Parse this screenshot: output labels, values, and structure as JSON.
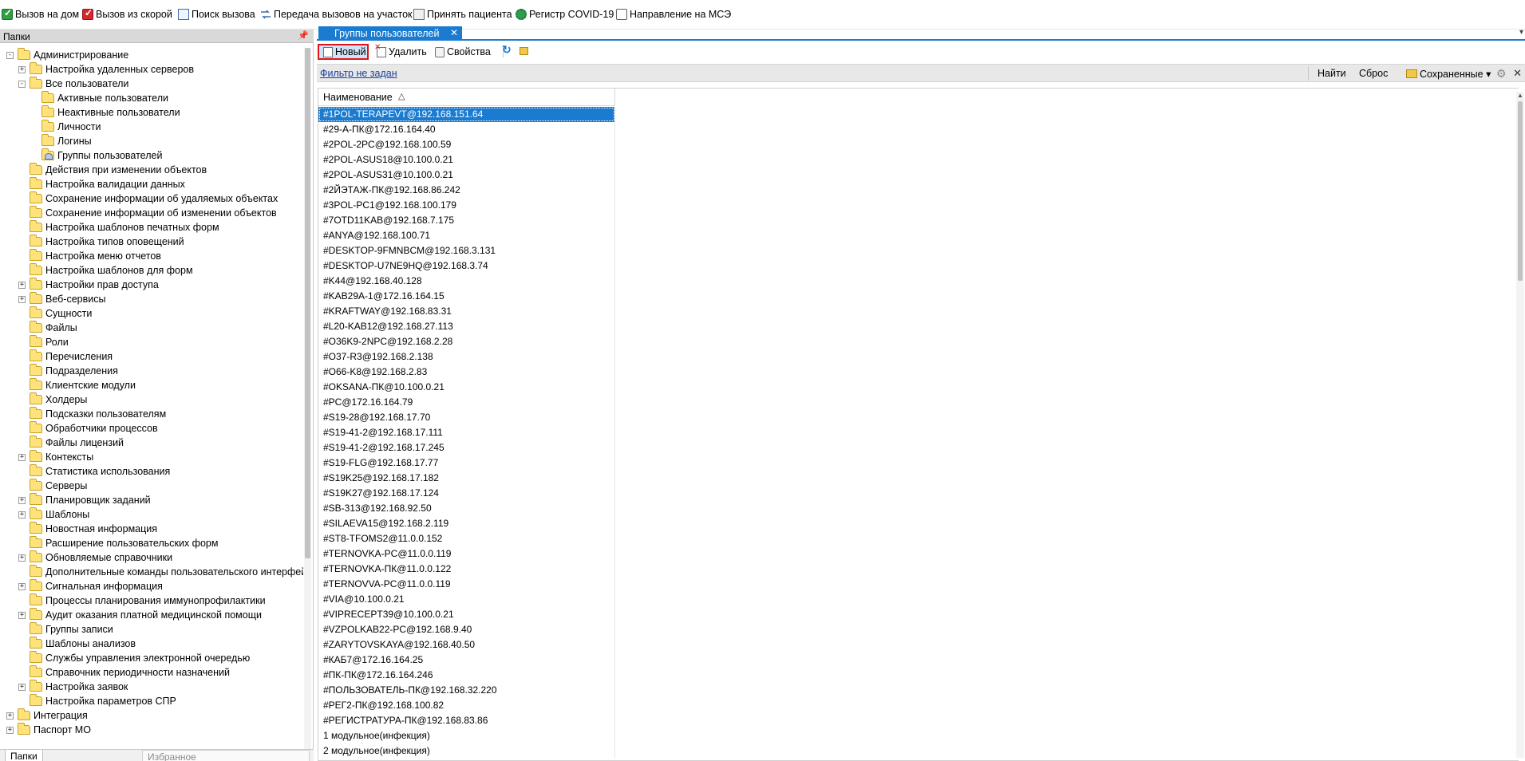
{
  "toolbar": {
    "items": [
      {
        "label": "Вызов на дом",
        "icon": "home-call-icon"
      },
      {
        "label": "Вызов из скорой",
        "icon": "ambulance-call-icon"
      },
      {
        "label": "Поиск вызова",
        "icon": "search-call-icon"
      },
      {
        "label": "Передача вызовов на участок",
        "icon": "transfer-icon"
      },
      {
        "label": "Принять пациента",
        "icon": "accept-patient-icon"
      },
      {
        "label": "Регистр COVID-19",
        "icon": "covid-icon"
      },
      {
        "label": "Направление на МСЭ",
        "icon": "referral-icon"
      }
    ]
  },
  "left_panel": {
    "title": "Папки",
    "pin_icon": "pin-icon",
    "tabs": {
      "active": "Папки",
      "favorites": "Избранное"
    },
    "tree": [
      {
        "label": "Администрирование",
        "level": 0,
        "expander": "-"
      },
      {
        "label": "Настройка удаленных серверов",
        "level": 1,
        "expander": "+"
      },
      {
        "label": "Все пользователи",
        "level": 1,
        "expander": "-"
      },
      {
        "label": "Активные пользователи",
        "level": 2,
        "expander": ""
      },
      {
        "label": "Неактивные пользователи",
        "level": 2,
        "expander": ""
      },
      {
        "label": "Личности",
        "level": 2,
        "expander": ""
      },
      {
        "label": "Логины",
        "level": 2,
        "expander": ""
      },
      {
        "label": "Группы пользователей",
        "level": 2,
        "expander": "",
        "selected": true
      },
      {
        "label": "Действия при изменении объектов",
        "level": 1,
        "expander": ""
      },
      {
        "label": "Настройка валидации данных",
        "level": 1,
        "expander": ""
      },
      {
        "label": "Сохранение информации об удаляемых объектах",
        "level": 1,
        "expander": ""
      },
      {
        "label": "Сохранение информации об изменении объектов",
        "level": 1,
        "expander": ""
      },
      {
        "label": "Настройка шаблонов печатных форм",
        "level": 1,
        "expander": ""
      },
      {
        "label": "Настройка типов оповещений",
        "level": 1,
        "expander": ""
      },
      {
        "label": "Настройка меню отчетов",
        "level": 1,
        "expander": ""
      },
      {
        "label": "Настройка шаблонов для форм",
        "level": 1,
        "expander": ""
      },
      {
        "label": "Настройки прав доступа",
        "level": 1,
        "expander": "+"
      },
      {
        "label": "Веб-сервисы",
        "level": 1,
        "expander": "+"
      },
      {
        "label": "Сущности",
        "level": 1,
        "expander": ""
      },
      {
        "label": "Файлы",
        "level": 1,
        "expander": ""
      },
      {
        "label": "Роли",
        "level": 1,
        "expander": ""
      },
      {
        "label": "Перечисления",
        "level": 1,
        "expander": ""
      },
      {
        "label": "Подразделения",
        "level": 1,
        "expander": ""
      },
      {
        "label": "Клиентские модули",
        "level": 1,
        "expander": ""
      },
      {
        "label": "Холдеры",
        "level": 1,
        "expander": ""
      },
      {
        "label": "Подсказки пользователям",
        "level": 1,
        "expander": ""
      },
      {
        "label": "Обработчики процессов",
        "level": 1,
        "expander": ""
      },
      {
        "label": "Файлы лицензий",
        "level": 1,
        "expander": ""
      },
      {
        "label": "Контексты",
        "level": 1,
        "expander": "+"
      },
      {
        "label": "Статистика использования",
        "level": 1,
        "expander": ""
      },
      {
        "label": "Серверы",
        "level": 1,
        "expander": ""
      },
      {
        "label": "Планировщик заданий",
        "level": 1,
        "expander": "+"
      },
      {
        "label": "Шаблоны",
        "level": 1,
        "expander": "+"
      },
      {
        "label": "Новостная информация",
        "level": 1,
        "expander": ""
      },
      {
        "label": "Расширение пользовательских форм",
        "level": 1,
        "expander": ""
      },
      {
        "label": "Обновляемые справочники",
        "level": 1,
        "expander": "+"
      },
      {
        "label": "Дополнительные команды пользовательского интерфейса",
        "level": 1,
        "expander": ""
      },
      {
        "label": "Сигнальная информация",
        "level": 1,
        "expander": "+"
      },
      {
        "label": "Процессы планирования иммунопрофилактики",
        "level": 1,
        "expander": ""
      },
      {
        "label": "Аудит оказания платной медицинской помощи",
        "level": 1,
        "expander": "+"
      },
      {
        "label": "Группы записи",
        "level": 1,
        "expander": ""
      },
      {
        "label": "Шаблоны анализов",
        "level": 1,
        "expander": ""
      },
      {
        "label": "Службы управления электронной очередью",
        "level": 1,
        "expander": ""
      },
      {
        "label": "Справочник периодичности назначений",
        "level": 1,
        "expander": ""
      },
      {
        "label": "Настройка заявок",
        "level": 1,
        "expander": "+"
      },
      {
        "label": "Настройка параметров СПР",
        "level": 1,
        "expander": ""
      },
      {
        "label": "Интеграция",
        "level": 0,
        "expander": "+"
      },
      {
        "label": "Паспорт МО",
        "level": 0,
        "expander": "+"
      }
    ]
  },
  "document_tab": {
    "title": "Группы пользователей",
    "close": "✕"
  },
  "actions": {
    "new": "Новый",
    "delete": "Удалить",
    "properties": "Свойства"
  },
  "filter": {
    "link": "Фильтр не задан",
    "find": "Найти",
    "reset": "Сброс",
    "saved": "Сохраненные",
    "close": "✕"
  },
  "grid": {
    "column": "Наименование",
    "sort_direction": "ascending",
    "selected_row": 0,
    "rows": [
      "#1POL-TERAPEVT@192.168.151.64",
      "#29-А-ПК@172.16.164.40",
      "#2POL-2PC@192.168.100.59",
      "#2POL-ASUS18@10.100.0.21",
      "#2POL-ASUS31@10.100.0.21",
      "#2ЙЭТАЖ-ПК@192.168.86.242",
      "#3POL-PC1@192.168.100.179",
      "#7OTD11KAB@192.168.7.175",
      "#ANYA@192.168.100.71",
      "#DESKTOP-9FMNBCM@192.168.3.131",
      "#DESKTOP-U7NE9HQ@192.168.3.74",
      "#K44@192.168.40.128",
      "#KAB29A-1@172.16.164.15",
      "#KRAFTWAY@192.168.83.31",
      "#L20-KAB12@192.168.27.113",
      "#O36K9-2NPC@192.168.2.28",
      "#O37-R3@192.168.2.138",
      "#O66-K8@192.168.2.83",
      "#OKSANA-ПК@10.100.0.21",
      "#PC@172.16.164.79",
      "#S19-28@192.168.17.70",
      "#S19-41-2@192.168.17.111",
      "#S19-41-2@192.168.17.245",
      "#S19-FLG@192.168.17.77",
      "#S19K25@192.168.17.182",
      "#S19K27@192.168.17.124",
      "#SB-313@192.168.92.50",
      "#SILAEVA15@192.168.2.119",
      "#ST8-TFOMS2@11.0.0.152",
      "#TERNOVKA-PC@11.0.0.119",
      "#TERNOVKA-ПК@11.0.0.122",
      "#TERNOVVA-PC@11.0.0.119",
      "#VIA@10.100.0.21",
      "#VIPRECEPT39@10.100.0.21",
      "#VZPOLKAB22-PC@192.168.9.40",
      "#ZARYTOVSKAYA@192.168.40.50",
      "#КАБ7@172.16.164.25",
      "#ПК-ПК@172.16.164.246",
      "#ПОЛЬЗОВАТЕЛЬ-ПК@192.168.32.220",
      "#РЕГ2-ПК@192.168.100.82",
      "#РЕГИСТРАТУРА-ПК@192.168.83.86",
      "1 модульное(инфекция)",
      "2 модульное(инфекция)"
    ]
  }
}
